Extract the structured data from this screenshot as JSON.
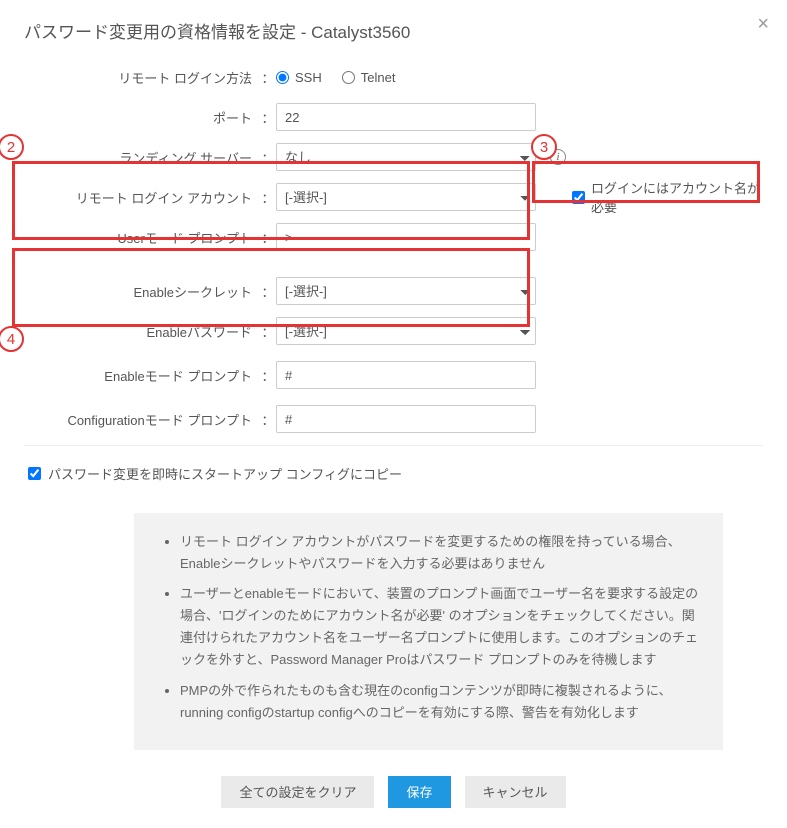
{
  "dialog": {
    "title": "パスワード変更用の資格情報を設定 - Catalyst3560"
  },
  "labels": {
    "remote_login_method": "リモート ログイン方法",
    "port": "ポート",
    "landing_server": "ランディング サーバー",
    "remote_login_account": "リモート ログイン アカウント",
    "user_mode_prompt": "Userモード プロンプト",
    "enable_secret": "Enableシークレット",
    "enable_password": "Enableパスワード",
    "enable_mode_prompt": "Enableモード プロンプト",
    "config_mode_prompt": "Configurationモード プロンプト"
  },
  "radios": {
    "ssh": "SSH",
    "telnet": "Telnet"
  },
  "values": {
    "port": "22",
    "landing_server": "なし",
    "remote_login_account": "[-選択-]",
    "user_mode_prompt": ">",
    "enable_secret": "[-選択-]",
    "enable_password": "[-選択-]",
    "enable_mode_prompt": "#",
    "config_mode_prompt": "#"
  },
  "checkboxes": {
    "login_requires_account": "ログインにはアカウント名が必要",
    "copy_startup": "パスワード変更を即時にスタートアップ コンフィグにコピー"
  },
  "notes": {
    "n1": "リモート ログイン アカウントがパスワードを変更するための権限を持っている場合、Enableシークレットやパスワードを入力する必要はありません",
    "n2": "ユーザーとenableモードにおいて、装置のプロンプト画面でユーザー名を要求する設定の場合、'ログインのためにアカウント名が必要' のオプションをチェックしてください。関連付けられたアカウント名をユーザー名プロンプトに使用します。このオプションのチェックを外すと、Password Manager Proはパスワード プロンプトのみを待機します",
    "n3": "PMPの外で作られたものも含む現在のconfigコンテンツが即時に複製されるように、running configのstartup configへのコピーを有効にする際、警告を有効化します"
  },
  "buttons": {
    "clear": "全ての設定をクリア",
    "save": "保存",
    "cancel": "キャンセル"
  },
  "annotations": {
    "a2": "2",
    "a3": "3",
    "a4": "4"
  }
}
